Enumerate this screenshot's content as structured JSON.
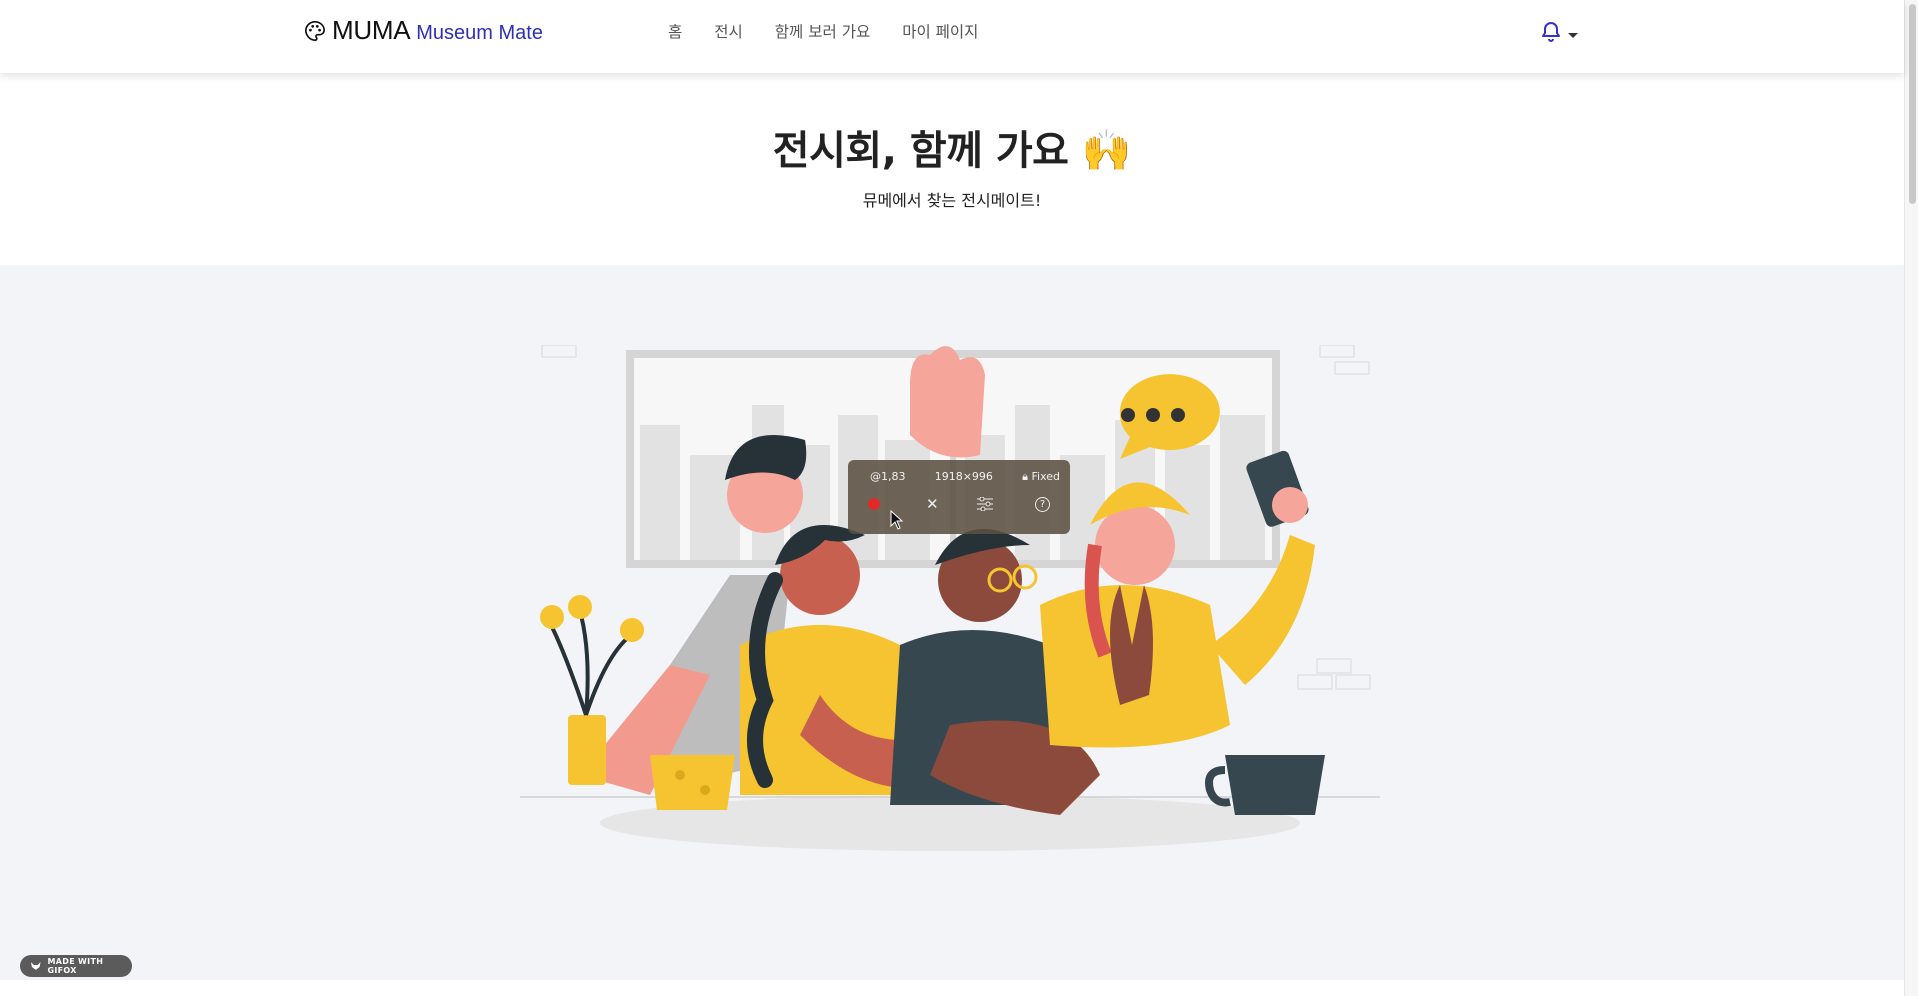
{
  "brand": {
    "name": "MUMA",
    "subtitle": "Museum Mate"
  },
  "nav": {
    "items": [
      "홈",
      "전시",
      "함께 보러 가요",
      "마이 페이지"
    ]
  },
  "hero": {
    "title": "전시회, 함께 가요 🙌",
    "subtitle": "뮤메에서 찾는 전시메이트!"
  },
  "recorder": {
    "position": "@1,83",
    "size": "1918×996",
    "mode": "Fixed",
    "help": "?"
  },
  "badge": {
    "label": "MADE WITH GIFOX"
  },
  "colors": {
    "brand_accent": "#2f2fb5",
    "bell": "#3333cc",
    "yellow": "#f5c430",
    "section_bg": "#f3f4f8"
  }
}
